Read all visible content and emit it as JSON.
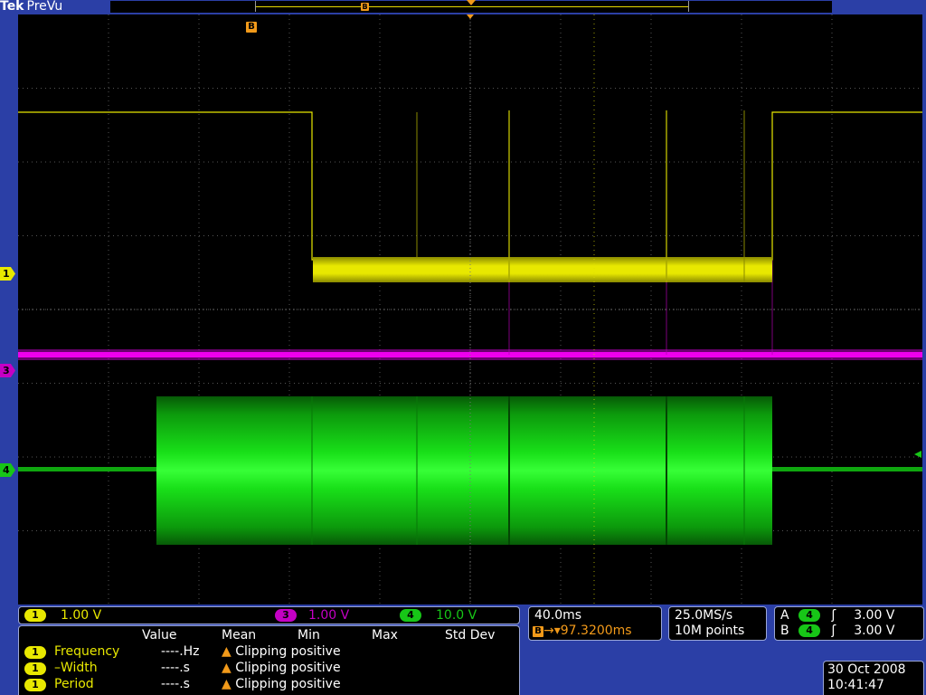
{
  "header": {
    "brand": "Tek",
    "mode": "PreVu",
    "record_marker": "B"
  },
  "display": {
    "b_marker": "B",
    "channel_markers": [
      {
        "label": "1",
        "color": "#e8e800"
      },
      {
        "label": "3",
        "color": "#c400c4"
      },
      {
        "label": "4",
        "color": "#17c617"
      }
    ]
  },
  "channels_bar": {
    "ch1": {
      "num": "1",
      "scale": "1.00 V",
      "color": "#e8e800"
    },
    "ch3": {
      "num": "3",
      "scale": "1.00 V",
      "color": "#c400c4"
    },
    "ch4": {
      "num": "4",
      "scale": "10.0 V",
      "color": "#17c617"
    }
  },
  "timebase": {
    "scale": "40.0ms",
    "delay_icon": "B",
    "delay": "97.3200ms"
  },
  "acquisition": {
    "rate": "25.0MS/s",
    "points": "10M points"
  },
  "trigger": {
    "a": {
      "label": "A",
      "source": "4",
      "slope": "ʃ",
      "level": "3.00 V"
    },
    "b": {
      "label": "B",
      "source": "4",
      "slope": "ʃ",
      "level": "3.00 V"
    }
  },
  "measurements": {
    "headers": [
      "Value",
      "Mean",
      "Min",
      "Max",
      "Std Dev"
    ],
    "rows": [
      {
        "ch": "1",
        "name": "Frequency",
        "value": "----.Hz",
        "status": "Clipping positive"
      },
      {
        "ch": "1",
        "name": "–Width",
        "value": "----.s",
        "status": "Clipping positive"
      },
      {
        "ch": "1",
        "name": "Period",
        "value": "----.s",
        "status": "Clipping positive"
      }
    ]
  },
  "datetime": {
    "date": "30 Oct  2008",
    "time": "10:41:47"
  },
  "colors": {
    "ch1": "#e8e800",
    "ch3": "#c400c4",
    "ch4": "#17c617",
    "marker": "#f29a1a",
    "frame": "#2b3fa6"
  }
}
